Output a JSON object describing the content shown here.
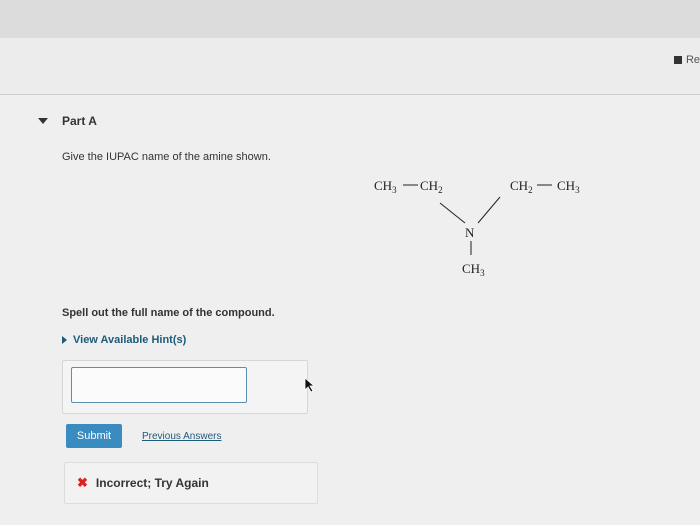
{
  "header": {
    "review_label": "Re"
  },
  "part": {
    "title": "Part A",
    "question": "Give the IUPAC name of the amine shown."
  },
  "molecule": {
    "left_group": [
      "CH3",
      "CH2"
    ],
    "right_group": [
      "CH2",
      "CH3"
    ],
    "center_atom": "N",
    "bottom_group": "CH3"
  },
  "answer": {
    "instruction": "Spell out the full name of the compound.",
    "hint_label": "View Available Hint(s)",
    "input_value": ""
  },
  "actions": {
    "submit_label": "Submit",
    "previous_label": "Previous Answers"
  },
  "feedback": {
    "icon": "x-icon",
    "text": "Incorrect; Try Again",
    "color": "#dd2222"
  }
}
